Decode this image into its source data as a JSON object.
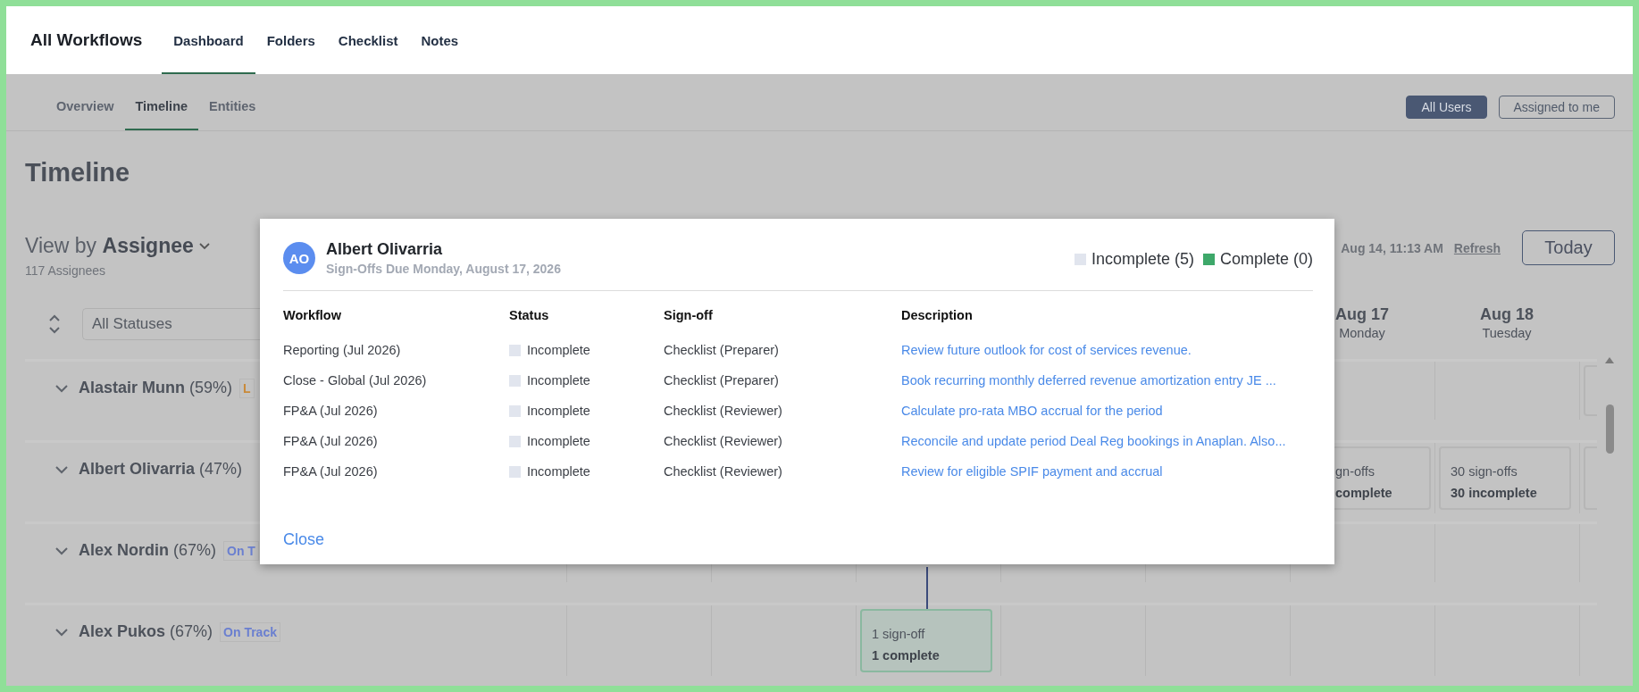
{
  "top_bar": {
    "title": "All Workflows",
    "tabs": [
      {
        "label": "Dashboard",
        "selected": true
      },
      {
        "label": "Folders",
        "selected": false
      },
      {
        "label": "Checklist",
        "selected": false
      },
      {
        "label": "Notes",
        "selected": false
      }
    ]
  },
  "sub_nav": {
    "tabs": [
      {
        "label": "Overview",
        "selected": false
      },
      {
        "label": "Timeline",
        "selected": true
      },
      {
        "label": "Entities",
        "selected": false
      }
    ],
    "user_filter": [
      {
        "label": "All Users",
        "selected": true
      },
      {
        "label": "Assigned to me",
        "selected": false
      }
    ]
  },
  "page_title": "Timeline",
  "view_by": "View by **Assignee**",
  "assignee_count": "117 Assignees",
  "last_updated": "Aug 14, 11:13 AM",
  "refresh": "Refresh",
  "today_button": "Today",
  "timeline": {
    "status_filter": "All Statuses",
    "columns": [
      {
        "kind": "blank"
      },
      {
        "kind": "blank"
      },
      {
        "kind": "blank"
      },
      {
        "kind": "blank"
      },
      {
        "kind": "blank"
      },
      {
        "kind": "blank"
      },
      {
        "kind": "date",
        "date": "Aug 17",
        "weekday": "Monday"
      },
      {
        "kind": "date",
        "date": "Aug 18",
        "weekday": "Tuesday"
      },
      {
        "kind": "blank"
      }
    ],
    "rows": [
      {
        "name": "**Alastair Munn** (59%)",
        "badge": {
          "text": "L",
          "color": "#c98a3a"
        },
        "cells": [
          {
            "kind": "empty"
          },
          {
            "kind": "empty"
          },
          {
            "kind": "empty"
          },
          {
            "kind": "empty"
          },
          {
            "kind": "empty"
          },
          {
            "kind": "empty"
          },
          {
            "kind": "empty"
          },
          {
            "kind": "empty"
          },
          {
            "kind": "card",
            "done": false
          }
        ]
      },
      {
        "name": "**Albert Olivarria** (47%)",
        "cells": [
          {
            "kind": "empty"
          },
          {
            "kind": "empty"
          },
          {
            "kind": "empty"
          },
          {
            "kind": "empty"
          },
          {
            "kind": "empty"
          },
          {
            "kind": "empty"
          },
          {
            "kind": "card",
            "done": false,
            "count": "gn-offs",
            "summary": "complete"
          },
          {
            "kind": "card",
            "done": false,
            "count": "30 sign-offs",
            "summary": "30 incomplete"
          },
          {
            "kind": "card",
            "done": false
          }
        ]
      },
      {
        "name": "**Alex Nordin** (67%)",
        "badge": {
          "text": "On T",
          "color": "#6a7fd0"
        },
        "cells": [
          {
            "kind": "empty"
          },
          {
            "kind": "empty"
          },
          {
            "kind": "empty"
          },
          {
            "kind": "empty"
          },
          {
            "kind": "empty"
          },
          {
            "kind": "empty"
          },
          {
            "kind": "empty"
          },
          {
            "kind": "empty"
          },
          {
            "kind": "empty"
          }
        ]
      },
      {
        "name": "**Alex Pukos** (67%)",
        "badge": {
          "text": "On Track",
          "color": "#6a7fd0"
        },
        "cells": [
          {
            "kind": "empty"
          },
          {
            "kind": "empty"
          },
          {
            "kind": "empty"
          },
          {
            "kind": "card",
            "done": true,
            "linked": true,
            "count": "1 sign-off",
            "summary": "1 complete"
          },
          {
            "kind": "empty"
          },
          {
            "kind": "empty"
          },
          {
            "kind": "empty"
          },
          {
            "kind": "empty"
          },
          {
            "kind": "empty"
          }
        ]
      }
    ]
  },
  "modal": {
    "initials": "AO",
    "name": "Albert Olivarria",
    "subtitle": "Sign-Offs Due Monday, August 17, 2026",
    "legend": [
      {
        "label": "Incomplete (5)",
        "color": "#e1e5ee"
      },
      {
        "label": "Complete (0)",
        "color": "#3ea86a"
      }
    ],
    "columns": [
      "Workflow",
      "Status",
      "Sign-off",
      "Description"
    ],
    "rows": [
      {
        "workflow": "Reporting (Jul 2026)",
        "status": "Incomplete",
        "complete": false,
        "signoff": "Checklist (Preparer)",
        "description": "Review future outlook for cost of services revenue."
      },
      {
        "workflow": "Close - Global (Jul 2026)",
        "status": "Incomplete",
        "complete": false,
        "signoff": "Checklist (Preparer)",
        "description": "Book recurring monthly deferred revenue amortization entry JE ..."
      },
      {
        "workflow": "FP&A (Jul 2026)",
        "status": "Incomplete",
        "complete": false,
        "signoff": "Checklist (Reviewer)",
        "description": "Calculate pro-rata MBO accrual for the period"
      },
      {
        "workflow": "FP&A (Jul 2026)",
        "status": "Incomplete",
        "complete": false,
        "signoff": "Checklist (Reviewer)",
        "description": "Reconcile and update period Deal Reg bookings in Anaplan. Also..."
      },
      {
        "workflow": "FP&A (Jul 2026)",
        "status": "Incomplete",
        "complete": false,
        "signoff": "Checklist (Reviewer)",
        "description": "Review for eligible SPIF payment and accrual"
      }
    ],
    "close": "Close"
  }
}
